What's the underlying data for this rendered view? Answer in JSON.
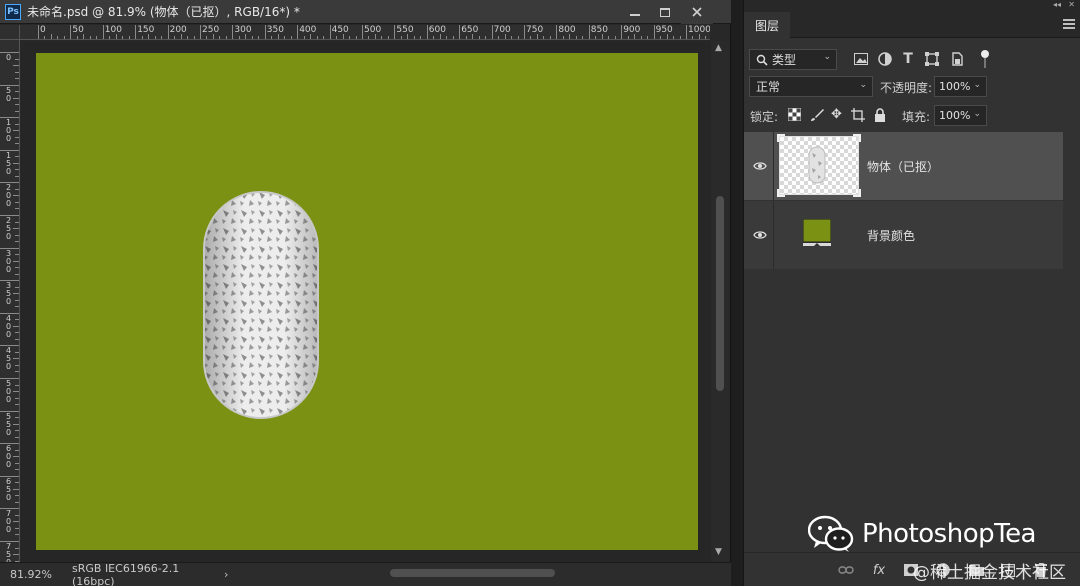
{
  "document": {
    "title": "未命名.psd @ 81.9% (物体（已抠）, RGB/16*) *",
    "app_icon": "Ps",
    "ruler_h_labels": [
      "0",
      "50",
      "100",
      "150",
      "200",
      "250",
      "300",
      "350",
      "400",
      "450",
      "500",
      "550",
      "600",
      "650",
      "700",
      "750",
      "800",
      "850",
      "900",
      "950",
      "1000"
    ],
    "ruler_v_labels": [
      "0",
      "5 0",
      "1 0 0",
      "1 5 0",
      "2 0 0",
      "2 5 0",
      "3 0 0",
      "3 5 0",
      "4 0 0",
      "4 5 0",
      "5 0 0",
      "5 5 0",
      "6 0 0",
      "6 5 0",
      "7 0 0",
      "7 5 0"
    ],
    "canvas_color": "#7a9113",
    "status": {
      "zoom": "81.92%",
      "profile": "sRGB IEC61966-2.1 (16bpc)",
      "arrow": "›"
    }
  },
  "layers_panel": {
    "tab": "图层",
    "filter": {
      "label": "类型"
    },
    "blend_mode": "正常",
    "opacity_label": "不透明度:",
    "opacity_value": "100%",
    "lock_label": "锁定:",
    "fill_label": "填充:",
    "fill_value": "100%",
    "layers": [
      {
        "name": "物体（已抠）",
        "selected": true
      },
      {
        "name": "背景颜色",
        "selected": false,
        "swatch": "#7a9113"
      }
    ],
    "bottom_fx": "fx"
  },
  "watermark": {
    "brand": "PhotoshopTea",
    "site": "@稀土掘金技术社区"
  }
}
